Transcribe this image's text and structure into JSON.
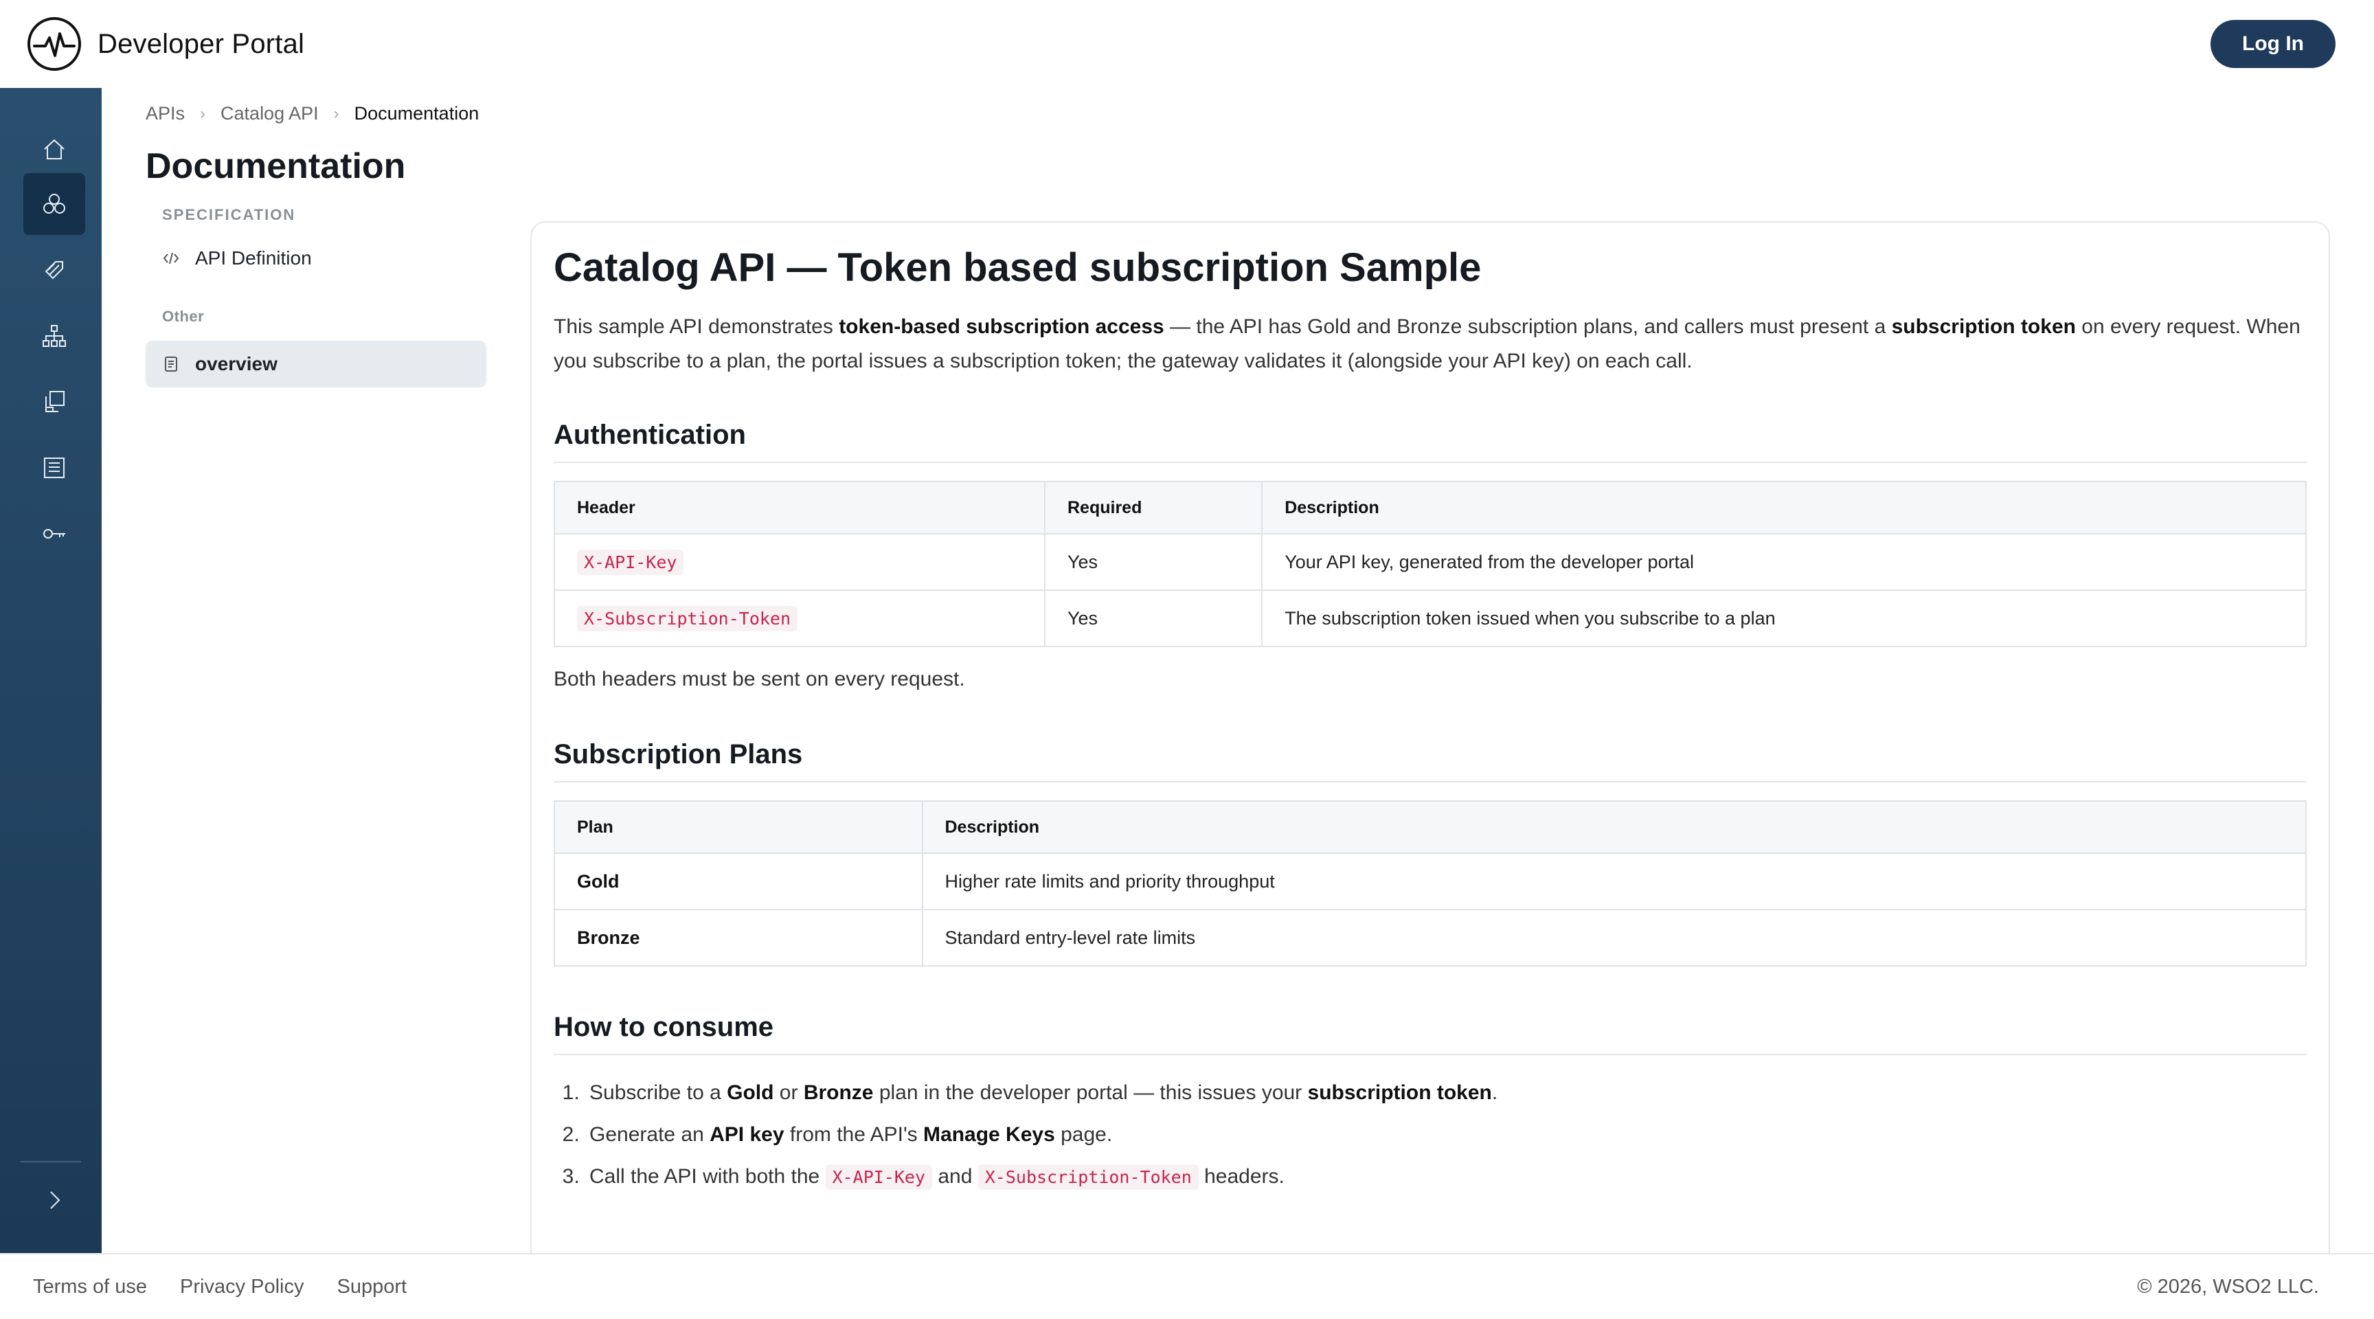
{
  "header": {
    "brand_name": "Developer Portal",
    "login_label": "Log In"
  },
  "rail": {
    "items": [
      "home-icon",
      "apis-icon",
      "products-icon",
      "organization-icon",
      "applications-icon",
      "catalog-icon",
      "key-icon"
    ],
    "active": "apis-icon",
    "expand_icon": "chevron-right-icon"
  },
  "breadcrumb": {
    "items": [
      "APIs",
      "Catalog API",
      "Documentation"
    ]
  },
  "page_title": "Documentation",
  "doc_nav": {
    "section_spec": "SPECIFICATION",
    "api_definition": "API Definition",
    "section_other": "Other",
    "overview": "overview"
  },
  "content": {
    "title": "Catalog API — Token based subscription Sample",
    "intro": {
      "p1": "This sample API demonstrates ",
      "b1": "token-based subscription access",
      "p2": " — the API has Gold and Bronze subscription plans, and callers must present a ",
      "b2": "subscription token",
      "p3": " on every request. When you subscribe to a plan, the portal issues a subscription token; the gateway validates it (alongside your API key) on each call."
    },
    "auth": {
      "heading": "Authentication",
      "columns": [
        "Header",
        "Required",
        "Description"
      ],
      "rows": [
        {
          "header": "X-API-Key",
          "required": "Yes",
          "description": "Your API key, generated from the developer portal"
        },
        {
          "header": "X-Subscription-Token",
          "required": "Yes",
          "description": "The subscription token issued when you subscribe to a plan"
        }
      ],
      "note": "Both headers must be sent on every request."
    },
    "plans": {
      "heading": "Subscription Plans",
      "columns": [
        "Plan",
        "Description"
      ],
      "rows": [
        {
          "plan": "Gold",
          "description": "Higher rate limits and priority throughput"
        },
        {
          "plan": "Bronze",
          "description": "Standard entry-level rate limits"
        }
      ]
    },
    "consume": {
      "heading": "How to consume",
      "step1": {
        "a": "Subscribe to a ",
        "b1": "Gold",
        "c": " or ",
        "b2": "Bronze",
        "d": " plan in the developer portal — this issues your ",
        "b3": "subscription token",
        "e": "."
      },
      "step2": {
        "a": "Generate an ",
        "b1": "API key",
        "c": " from the API's ",
        "b2": "Manage Keys",
        "d": " page."
      },
      "step3": {
        "a": "Call the API with both the ",
        "code1": "X-API-Key",
        "c": " and ",
        "code2": "X-Subscription-Token",
        "d": " headers."
      }
    }
  },
  "footer": {
    "links": [
      "Terms of use",
      "Privacy Policy",
      "Support"
    ],
    "copyright": "© 2026, WSO2 LLC."
  },
  "colors": {
    "rail_top": "#2a4f6e",
    "rail_bottom": "#1c3a57",
    "primary_button": "#1f3a5a",
    "code_text": "#c7254e"
  }
}
